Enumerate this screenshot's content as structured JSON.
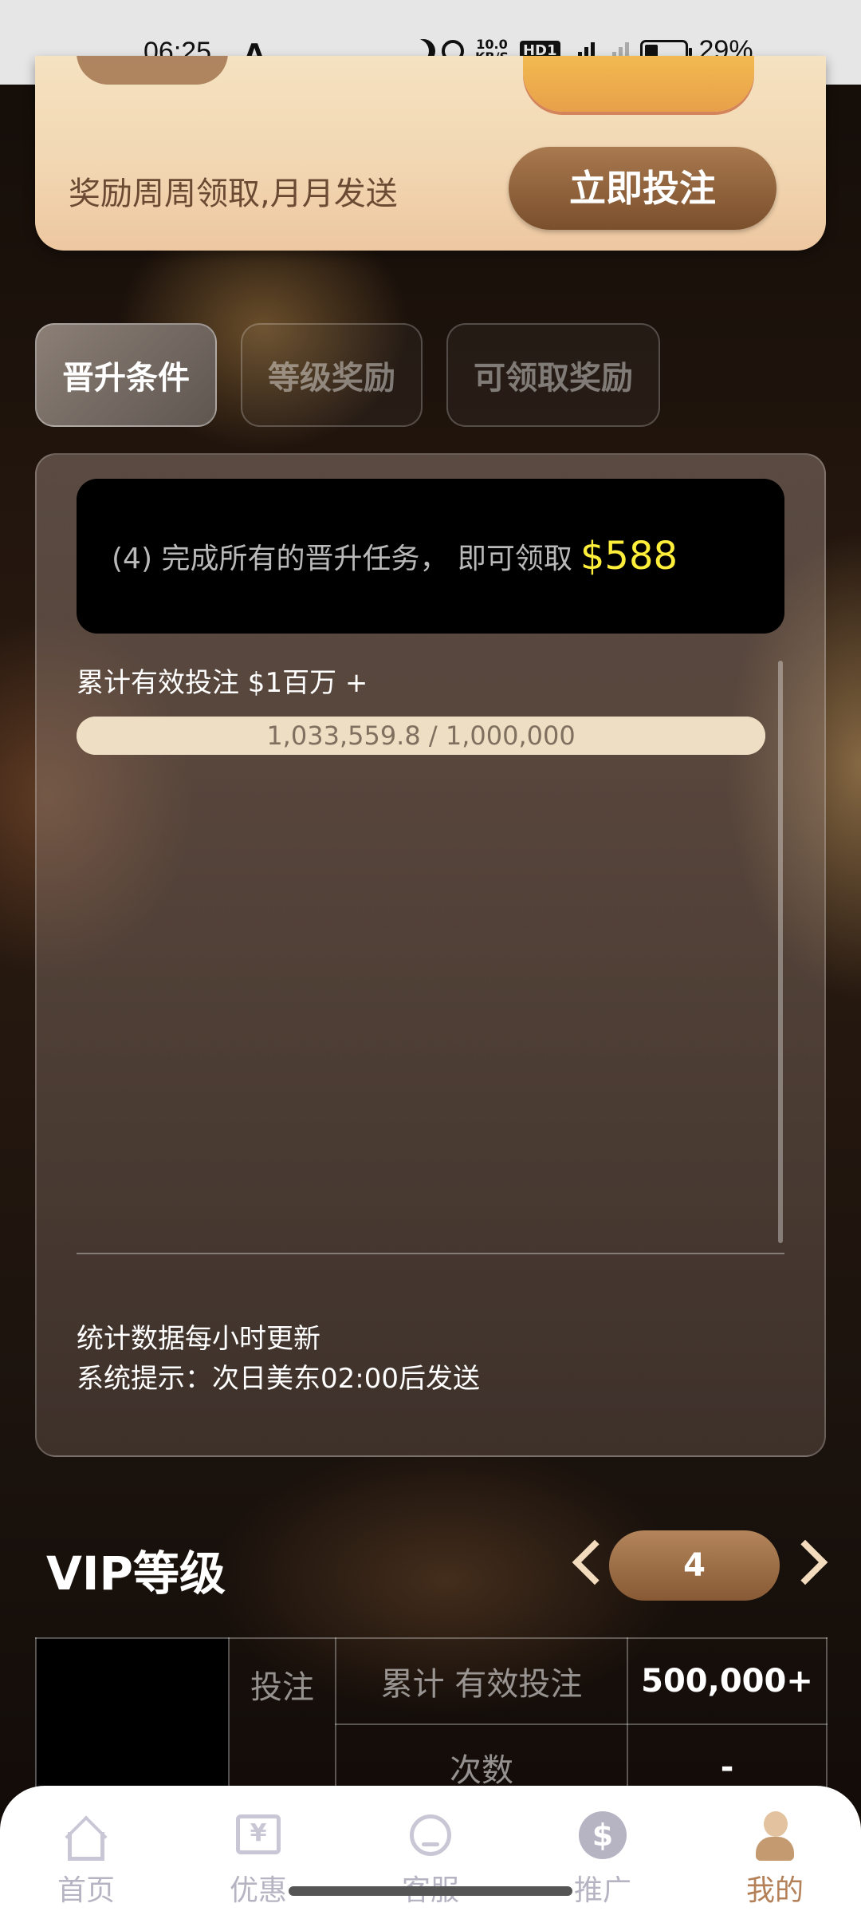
{
  "status_bar": {
    "time": "06:25",
    "net_speed_top": "10.0",
    "net_speed_unit": "KB/S",
    "hd": "HD1",
    "network": "4G",
    "battery": "29%"
  },
  "banner": {
    "text": "奖励周周领取,月月发送",
    "button": "立即投注"
  },
  "tabs": [
    {
      "label": "晋升条件",
      "active": true
    },
    {
      "label": "等级奖励",
      "active": false
    },
    {
      "label": "可领取奖励",
      "active": false
    }
  ],
  "panel": {
    "reward_text": "(4) 完成所有的晋升任务， 即可领取",
    "reward_amount": "$588",
    "condition_label": "累计有效投注 $1百万 +",
    "progress": {
      "text": "1,033,559.8 / 1,000,000",
      "fraction": 1.0
    },
    "note1": "统计数据每小时更新",
    "note2": "系统提示：次日美东02:00后发送"
  },
  "vip": {
    "title": "VIP等级",
    "level": "4"
  },
  "table": {
    "row1": {
      "category": "投注",
      "label": "累计 有效投注",
      "value": "500,000+"
    },
    "row2": {
      "label": "次数",
      "value": "-"
    }
  },
  "bottom_nav": [
    {
      "label": "首页",
      "icon": "home-icon"
    },
    {
      "label": "优惠",
      "icon": "coupon-icon"
    },
    {
      "label": "客服",
      "icon": "customer-service-icon"
    },
    {
      "label": "推广",
      "icon": "promotion-icon"
    },
    {
      "label": "我的",
      "icon": "profile-icon",
      "active": true
    }
  ],
  "colors": {
    "accent_gold": "#a9794f",
    "reward_yellow": "#ffef3a",
    "progress_bg": "#eedfc4",
    "active_nav": "#b48058"
  }
}
